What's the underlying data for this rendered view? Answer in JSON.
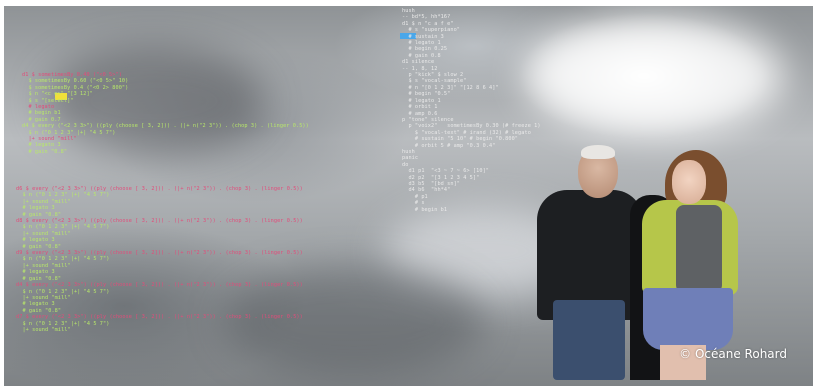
{
  "code_left": [
    "d1 $ sometimesBy 0.40 (\"<0 5>\")",
    "  $ sometimesBy 0.60 (\"<0 5>\" 10)",
    "  $ sometimesBy 0.4 (\"<0 2> 800\")",
    "  $ n \"<c e>\" \"[3 12]\"",
    "  $ s \"[select]\"",
    "  # legato",
    "  # begin b1",
    "  # gain 0.7",
    "d4 $ every (\"<2 3 3>\") ((ply (choose [ 3, 2])) . (|+ n(\"2 3\")) . (chop 3) . (linger 0.5))",
    "  $ n (\"0 1 2 3\" |+| \"4 5 7\")",
    "  |+ sound \"mill\"",
    "  # legato 3",
    "  # gain \"0.8\""
  ],
  "code_left_b": [
    "d6 $ every (\"<2 3 3>\") ((ply (choose [ 3, 2])) . (|+ n(\"2 3\")) . (chop 3) . (linger 0.5))",
    "  $ n (\"0 1 2 3\" |+| \"4 5 7\")",
    "  |+ sound \"mill\"",
    "  # legato 3",
    "  # gain \"0.8\"",
    "d8 $ every (\"<2 3 3>\") ((ply (choose [ 3, 2])) . (|+ n(\"2 3\")) . (chop 3) . (linger 0.5))",
    "  $ n (\"0 1 2 3\" |+| \"4 5 7\")",
    "  |+ sound \"mill\"",
    "  # legato 3",
    "  # gain \"0.8\"",
    "d9 $ every (\"<2 3 3>\") ((ply (choose [ 3, 2])) . (|+ n(\"2 3\")) . (chop 3) . (linger 0.5))",
    "  $ n (\"0 1 2 3\" |+| \"4 5 7\")",
    "  |+ sound \"mill\"",
    "  # legato 3",
    "  # gain \"0.8\"",
    "d4 $ every (\"<2 3 3>\") ((ply (choose [ 3, 2])) . (|+ n(\"2 3\")) . (chop 3) . (linger 0.5))",
    "  $ n (\"0 1 2 3\" |+| \"4 5 7\")",
    "  |+ sound \"mill\"",
    "  # legato 3",
    "  # gain \"0.8\"",
    "d7 $ every (\"<2 3 3>\") ((ply (choose [ 3, 2])) . (|+ n(\"2 3\")) . (chop 3) . (linger 0.5))",
    "  $ n (\"0 1 2 3\" |+| \"4 5 7\")",
    "  |+ sound \"mill\""
  ],
  "code_right": [
    "hush",
    "-- bd*5, hh*16?",
    "",
    "d1 $ n \"c a f e\"",
    "  # s \"superpiano\"",
    "  # sustain 3",
    "  # legato 1",
    "  # begin 0.25",
    "  # gain 0.8",
    "",
    "d1 silence",
    "",
    "-- 1, 8, 12",
    "",
    "  p \"kick\" $ slow 2",
    "  $ s \"vocal-sample\"",
    "  # n \"[0 1 2 3]\" \"[12 8 6 4]\"",
    "  # begin \"0.5\"",
    "  # legato 1",
    "  # orbit 1",
    "  # amp 0.6",
    "",
    "p \"tone\" silence",
    "",
    "  p \"voix2\"   sometimesBy 0.30 (# freeze 1)",
    "    $ \"vocal-text\" # irand (32) # legato",
    "    # sustain \"5 10\" # begin \"0.800\"",
    "    # orbit 5 # amp \"0.3 0.4\"",
    "",
    "hush",
    "",
    "panic",
    "",
    "do",
    "  d1 p1  \"<3 ~ 7 ~ 6> [10]\"",
    "  d2 p2  \"[3 1 2 3 4 5]\"",
    "  d3 b5  \"[bd sn]\"",
    "  d4 b6  \"hh*4\"",
    "    # p1",
    "    # s",
    "    # begin b1"
  ],
  "credit": "© Océane Rohard",
  "colors": {
    "accent_pink": "#e24c7a",
    "code_green": "#b8e86a",
    "highlight_yellow": "#f0e03a",
    "highlight_blue": "#4aa7ea"
  }
}
